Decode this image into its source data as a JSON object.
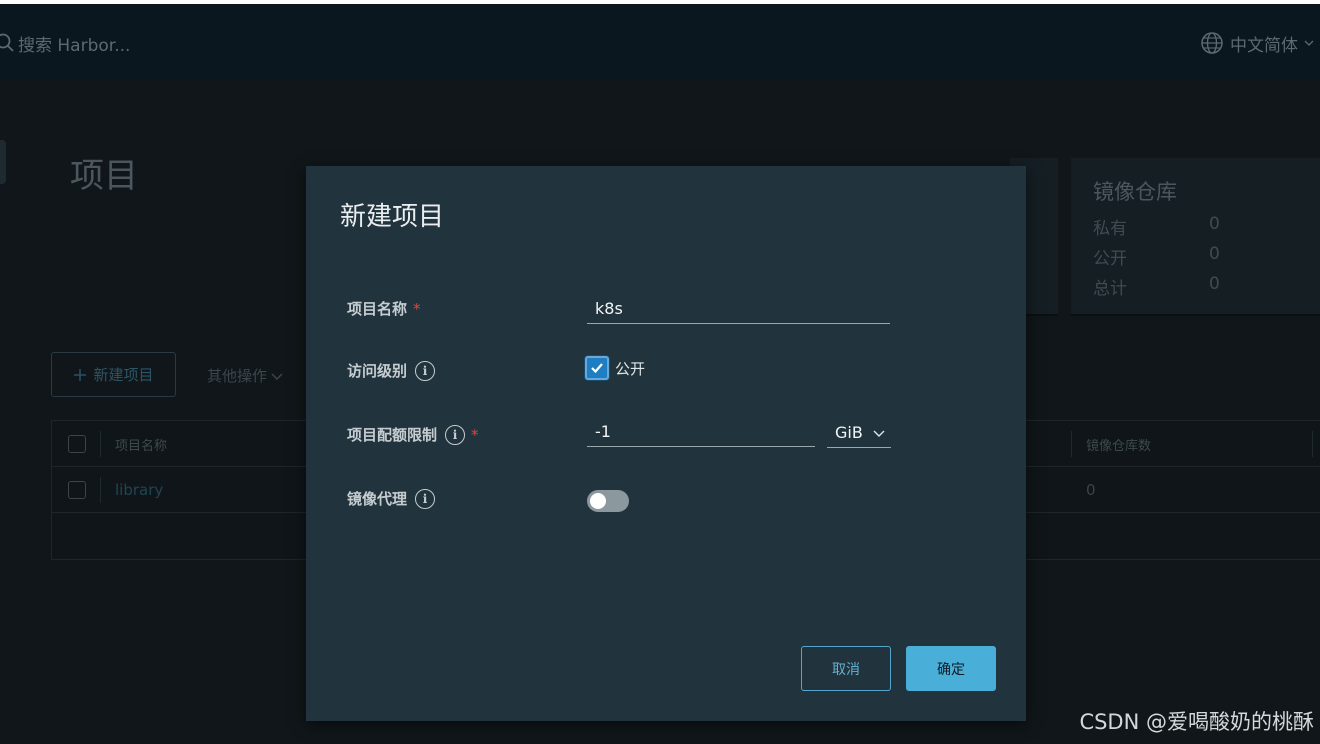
{
  "header": {
    "search_placeholder": "搜索 Harbor...",
    "language": "中文简体"
  },
  "page": {
    "title": "项目"
  },
  "repo_card": {
    "title": "镜像仓库",
    "rows": [
      {
        "label": "私有",
        "value": "0"
      },
      {
        "label": "公开",
        "value": "0"
      },
      {
        "label": "总计",
        "value": "0"
      }
    ]
  },
  "toolbar": {
    "new_project": "新建项目",
    "more_actions": "其他操作"
  },
  "table": {
    "col_name": "项目名称",
    "col_repo_count": "镜像仓库数",
    "rows": [
      {
        "name": "library",
        "repo_count": "0"
      }
    ]
  },
  "modal": {
    "title": "新建项目",
    "name_label": "项目名称",
    "name_value": "k8s",
    "access_label": "访问级别",
    "access_option": "公开",
    "quota_label": "项目配额限制",
    "quota_value": "-1",
    "quota_unit": "GiB",
    "proxy_label": "镜像代理",
    "required_mark": "*",
    "cancel": "取消",
    "confirm": "确定"
  },
  "watermark": "CSDN @爱喝酸奶的桃酥"
}
